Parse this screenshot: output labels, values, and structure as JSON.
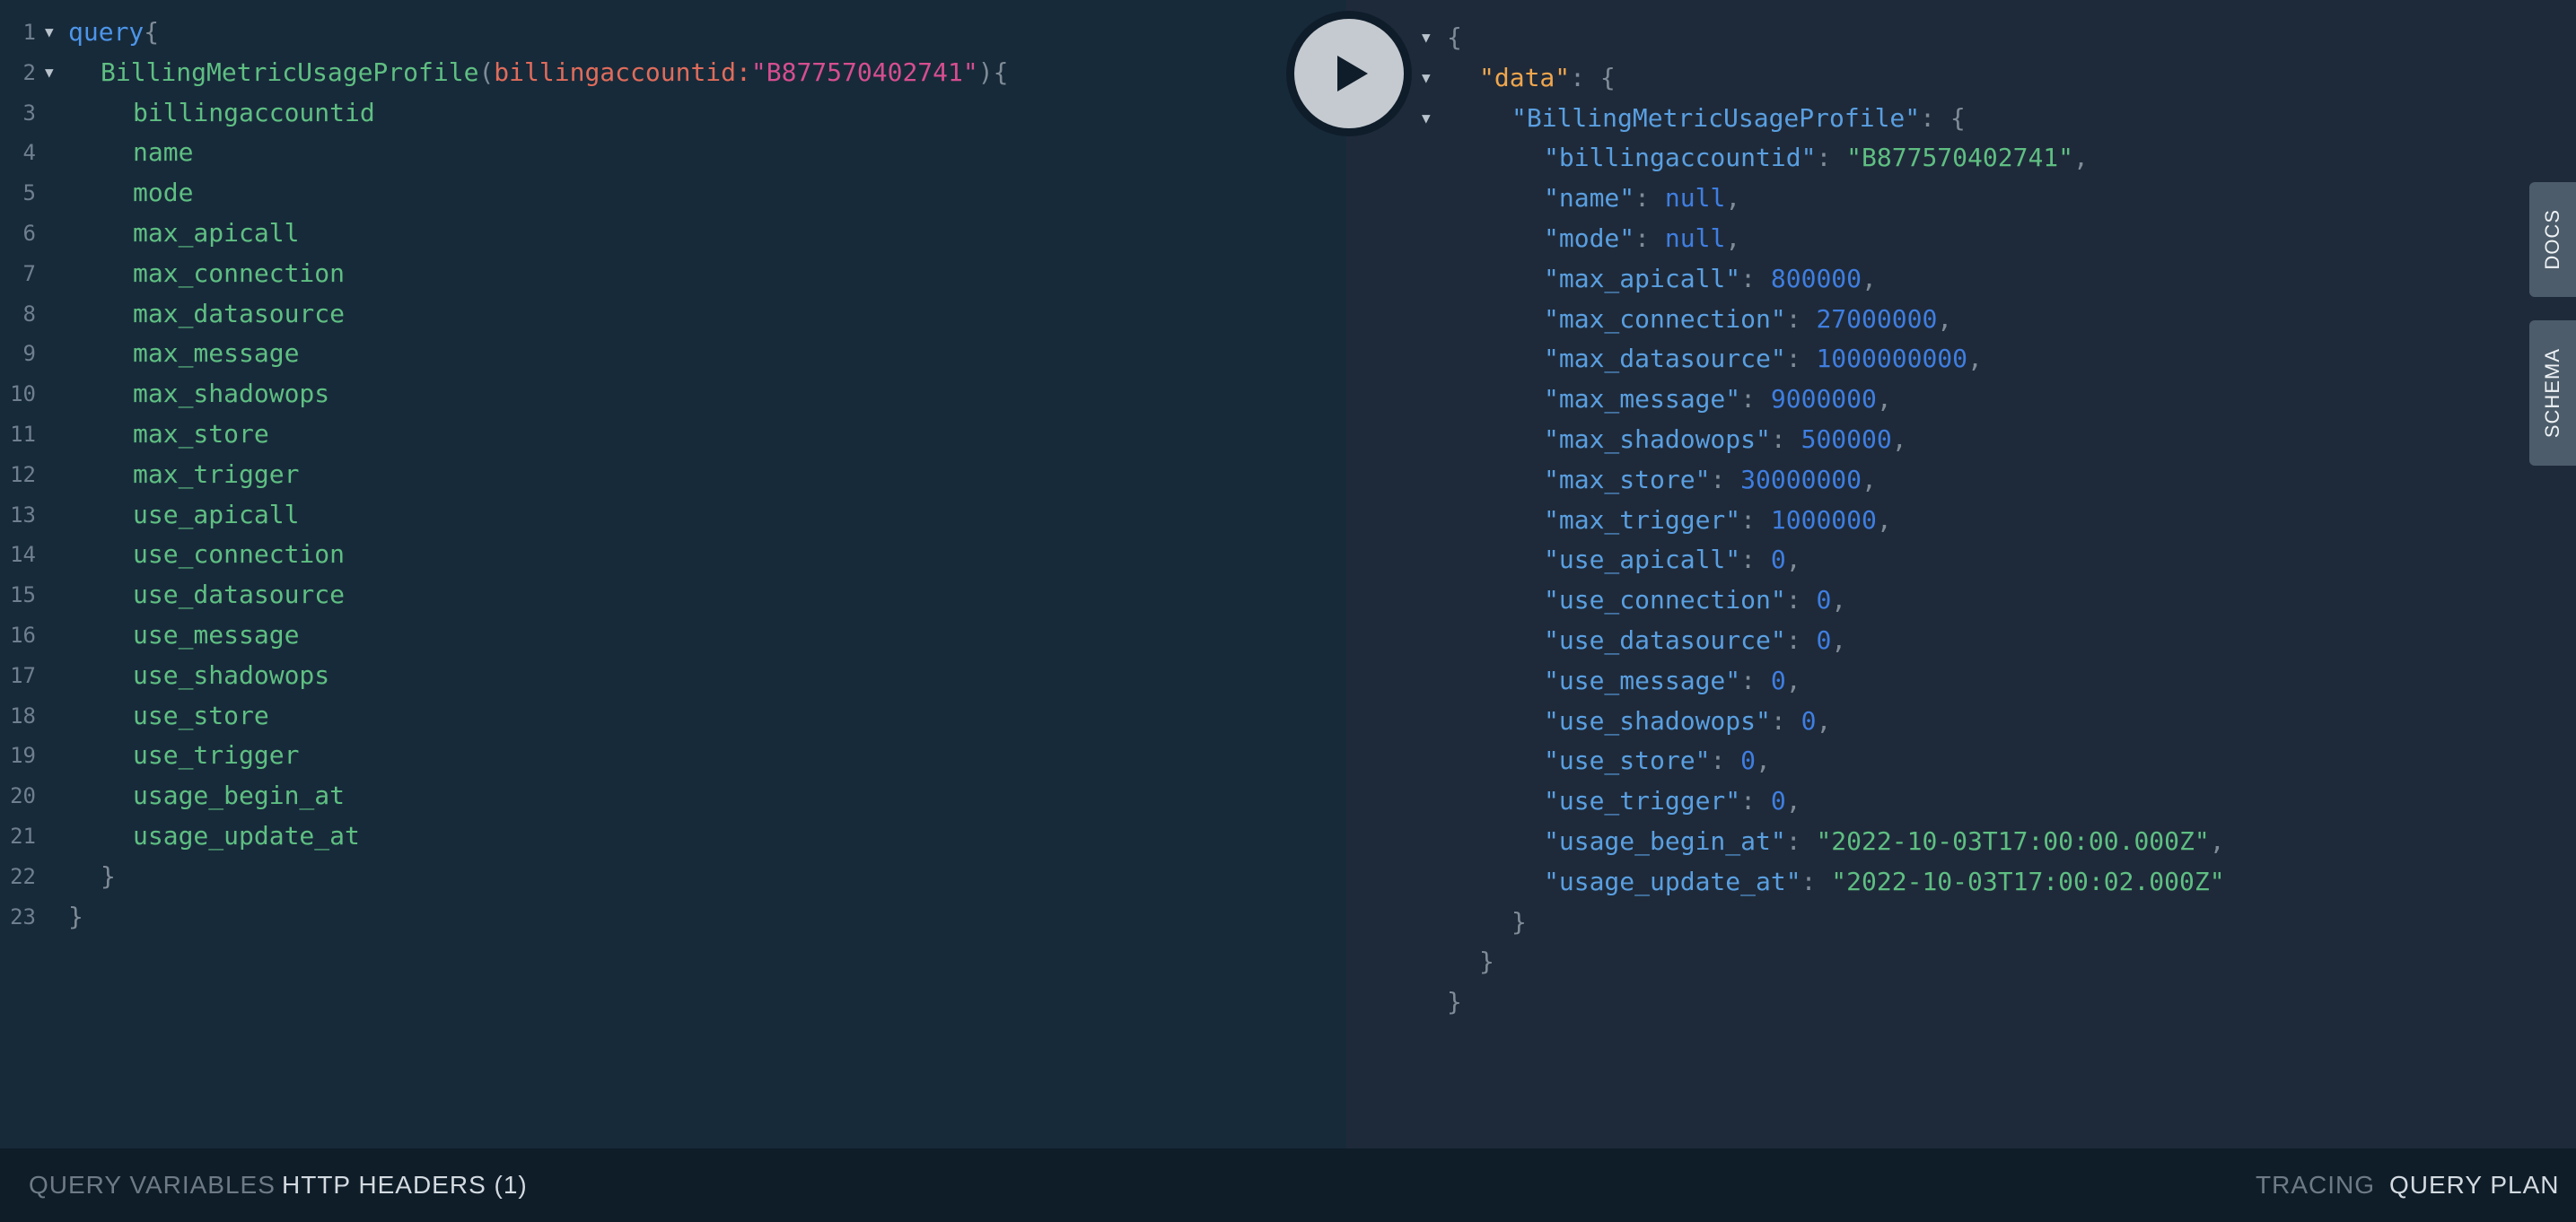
{
  "run_button": {
    "icon": "play-icon"
  },
  "editor": {
    "keyword": "query",
    "open_brace": "{",
    "operation": "BillingMetricUsageProfile",
    "paren_open": "(",
    "arg_name": "billingaccountid",
    "colon": ":",
    "arg_value": "\"B877570402741\"",
    "paren_close": "){",
    "fields": [
      "billingaccountid",
      "name",
      "mode",
      "max_apicall",
      "max_connection",
      "max_datasource",
      "max_message",
      "max_shadowops",
      "max_store",
      "max_trigger",
      "use_apicall",
      "use_connection",
      "use_datasource",
      "use_message",
      "use_shadowops",
      "use_store",
      "use_trigger",
      "usage_begin_at",
      "usage_update_at"
    ],
    "close_inner": "}",
    "close_outer": "}",
    "line_numbers": [
      "1",
      "2",
      "3",
      "4",
      "5",
      "6",
      "7",
      "8",
      "9",
      "10",
      "11",
      "12",
      "13",
      "14",
      "15",
      "16",
      "17",
      "18",
      "19",
      "20",
      "21",
      "22",
      "23"
    ]
  },
  "result": {
    "open": "{",
    "data_key": "\"data\"",
    "data_sep": ": {",
    "profile_key": "\"BillingMetricUsageProfile\"",
    "profile_sep": ": {",
    "entries": [
      {
        "key": "\"billingaccountid\"",
        "value": "\"B877570402741\"",
        "type": "str",
        "comma": ","
      },
      {
        "key": "\"name\"",
        "value": "null",
        "type": "null",
        "comma": ","
      },
      {
        "key": "\"mode\"",
        "value": "null",
        "type": "null",
        "comma": ","
      },
      {
        "key": "\"max_apicall\"",
        "value": "800000",
        "type": "num",
        "comma": ","
      },
      {
        "key": "\"max_connection\"",
        "value": "27000000",
        "type": "num",
        "comma": ","
      },
      {
        "key": "\"max_datasource\"",
        "value": "1000000000",
        "type": "num",
        "comma": ","
      },
      {
        "key": "\"max_message\"",
        "value": "9000000",
        "type": "num",
        "comma": ","
      },
      {
        "key": "\"max_shadowops\"",
        "value": "500000",
        "type": "num",
        "comma": ","
      },
      {
        "key": "\"max_store\"",
        "value": "30000000",
        "type": "num",
        "comma": ","
      },
      {
        "key": "\"max_trigger\"",
        "value": "1000000",
        "type": "num",
        "comma": ","
      },
      {
        "key": "\"use_apicall\"",
        "value": "0",
        "type": "num",
        "comma": ","
      },
      {
        "key": "\"use_connection\"",
        "value": "0",
        "type": "num",
        "comma": ","
      },
      {
        "key": "\"use_datasource\"",
        "value": "0",
        "type": "num",
        "comma": ","
      },
      {
        "key": "\"use_message\"",
        "value": "0",
        "type": "num",
        "comma": ","
      },
      {
        "key": "\"use_shadowops\"",
        "value": "0",
        "type": "num",
        "comma": ","
      },
      {
        "key": "\"use_store\"",
        "value": "0",
        "type": "num",
        "comma": ","
      },
      {
        "key": "\"use_trigger\"",
        "value": "0",
        "type": "num",
        "comma": ","
      },
      {
        "key": "\"usage_begin_at\"",
        "value": "\"2022-10-03T17:00:00.000Z\"",
        "type": "str",
        "comma": ","
      },
      {
        "key": "\"usage_update_at\"",
        "value": "\"2022-10-03T17:00:02.000Z\"",
        "type": "str",
        "comma": ""
      }
    ],
    "close": "}",
    "colon": ": "
  },
  "side_tabs": {
    "docs": "DOCS",
    "schema": "SCHEMA"
  },
  "bottom_bar": {
    "query_variables": "QUERY VARIABLES",
    "http_headers": "HTTP HEADERS (1)",
    "tracing": "TRACING",
    "query_plan": "QUERY PLAN"
  },
  "colors": {
    "editor_bg": "#172a3a",
    "result_bg": "#1e2a3a",
    "field": "#5fbf82",
    "keyword": "#4d95e8",
    "data_key": "#f0a64d"
  }
}
